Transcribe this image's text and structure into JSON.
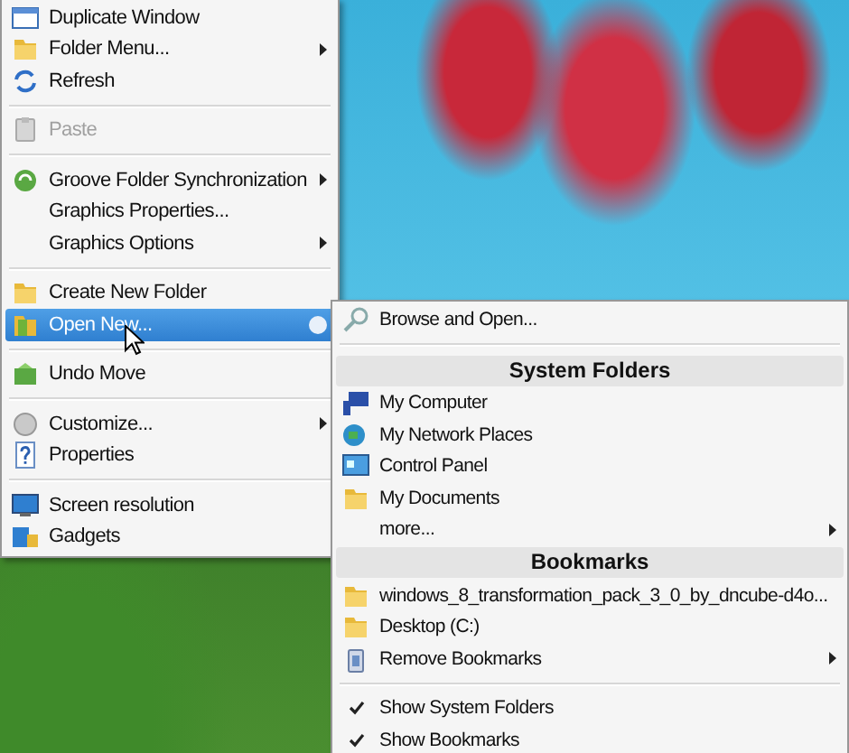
{
  "main_menu": {
    "items": [
      {
        "kind": "item",
        "label": "Duplicate Window",
        "submenu": false,
        "disabled": false,
        "selected": false
      },
      {
        "kind": "item",
        "label": "Folder Menu...",
        "submenu": true,
        "disabled": false,
        "selected": false
      },
      {
        "kind": "item",
        "label": "Refresh",
        "submenu": false,
        "disabled": false,
        "selected": false
      },
      {
        "kind": "separator"
      },
      {
        "kind": "item",
        "label": "Paste",
        "submenu": false,
        "disabled": true,
        "selected": false
      },
      {
        "kind": "separator"
      },
      {
        "kind": "item",
        "label": "Groove Folder Synchronization",
        "submenu": true,
        "disabled": false,
        "selected": false
      },
      {
        "kind": "item",
        "label": "Graphics Properties...",
        "submenu": false,
        "disabled": false,
        "selected": false
      },
      {
        "kind": "item",
        "label": "Graphics Options",
        "submenu": true,
        "disabled": false,
        "selected": false
      },
      {
        "kind": "separator"
      },
      {
        "kind": "item",
        "label": "Create New Folder",
        "submenu": false,
        "disabled": false,
        "selected": false
      },
      {
        "kind": "item",
        "label": "Open New...",
        "submenu": true,
        "disabled": false,
        "selected": true
      },
      {
        "kind": "separator"
      },
      {
        "kind": "item",
        "label": "Undo Move",
        "submenu": false,
        "disabled": false,
        "selected": false
      },
      {
        "kind": "separator"
      },
      {
        "kind": "item",
        "label": "Customize...",
        "submenu": true,
        "disabled": false,
        "selected": false
      },
      {
        "kind": "item",
        "label": "Properties",
        "submenu": false,
        "disabled": false,
        "selected": false
      },
      {
        "kind": "separator"
      },
      {
        "kind": "item",
        "label": "Screen resolution",
        "submenu": false,
        "disabled": false,
        "selected": false
      },
      {
        "kind": "item",
        "label": "Gadgets",
        "submenu": false,
        "disabled": false,
        "selected": false
      }
    ]
  },
  "open_new_submenu": {
    "items": [
      {
        "kind": "item",
        "label": "Browse and Open...",
        "submenu": false
      },
      {
        "kind": "separator"
      },
      {
        "kind": "header",
        "label": "System Folders"
      },
      {
        "kind": "item",
        "label": "My Computer",
        "submenu": false
      },
      {
        "kind": "item",
        "label": "My Network Places",
        "submenu": false
      },
      {
        "kind": "item",
        "label": "Control Panel",
        "submenu": false
      },
      {
        "kind": "item",
        "label": "My Documents",
        "submenu": false
      },
      {
        "kind": "item",
        "label": "more...",
        "submenu": true
      },
      {
        "kind": "header",
        "label": "Bookmarks"
      },
      {
        "kind": "item",
        "label": "windows_8_transformation_pack_3_0_by_dncube-d4o...",
        "submenu": false
      },
      {
        "kind": "item",
        "label": "Desktop (C:)",
        "submenu": false
      },
      {
        "kind": "item",
        "label": "Remove Bookmarks",
        "submenu": true
      },
      {
        "kind": "separator"
      },
      {
        "kind": "check",
        "label": "Show System Folders",
        "checked": true
      },
      {
        "kind": "check",
        "label": "Show Bookmarks",
        "checked": true
      }
    ]
  }
}
